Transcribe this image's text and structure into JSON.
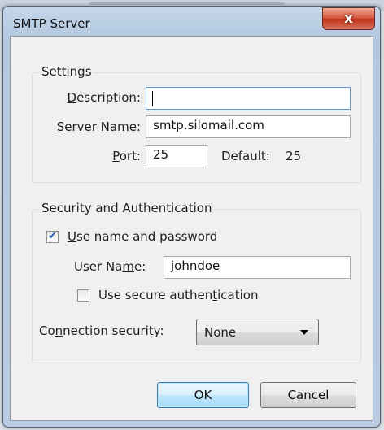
{
  "window": {
    "title": "SMTP Server",
    "close_label": "x"
  },
  "settings": {
    "legend": "Settings",
    "description": {
      "label_pre": "",
      "label_key": "D",
      "label_post": "escription:",
      "value": ""
    },
    "server_name": {
      "label_pre": "",
      "label_key": "S",
      "label_post": "erver Name:",
      "value": "smtp.silomail.com"
    },
    "port": {
      "label_pre": "",
      "label_key": "P",
      "label_post": "ort:",
      "value": "25"
    },
    "default": {
      "label": "Default:",
      "value": "25"
    }
  },
  "security": {
    "legend": "Security and Authentication",
    "use_name_password": {
      "label_pre": "",
      "label_key": "U",
      "label_post": "se name and password",
      "checked": true
    },
    "user_name": {
      "label_pre": "User Na",
      "label_key": "m",
      "label_post": "e:",
      "value": "johndoe"
    },
    "secure_auth": {
      "label_pre": "Use secure authen",
      "label_key": "t",
      "label_post": "ication",
      "checked": false
    },
    "connection_security": {
      "label_pre": "Co",
      "label_key": "n",
      "label_post": "nection security:",
      "selected": "None"
    }
  },
  "buttons": {
    "ok": "OK",
    "cancel": "Cancel"
  }
}
